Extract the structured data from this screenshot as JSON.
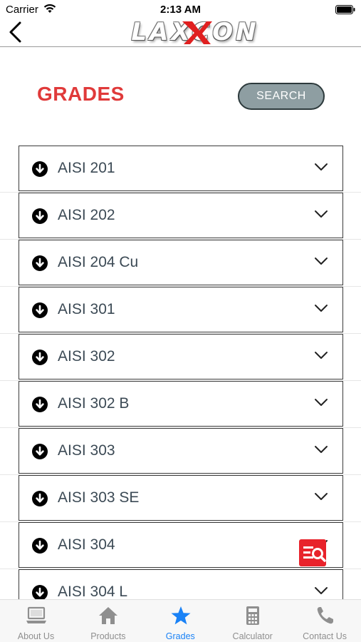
{
  "status_bar": {
    "carrier": "Carrier",
    "time": "2:13 AM"
  },
  "nav": {
    "logo_text": "LAXCON",
    "brand_color": "#e02020"
  },
  "page": {
    "title": "GRADES",
    "search_label": "SEARCH"
  },
  "grades": [
    {
      "label": "AISI 201"
    },
    {
      "label": "AISI 202"
    },
    {
      "label": "AISI 204 Cu"
    },
    {
      "label": "AISI 301"
    },
    {
      "label": "AISI 302"
    },
    {
      "label": "AISI 302 B"
    },
    {
      "label": "AISI 303"
    },
    {
      "label": "AISI 303 SE"
    },
    {
      "label": "AISI 304"
    },
    {
      "label": "AISI 304 L"
    }
  ],
  "tabs": [
    {
      "label": "About Us",
      "icon": "laptop-icon",
      "active": false
    },
    {
      "label": "Products",
      "icon": "home-icon",
      "active": false
    },
    {
      "label": "Grades",
      "icon": "star-icon",
      "active": true
    },
    {
      "label": "Calculator",
      "icon": "calculator-icon",
      "active": false
    },
    {
      "label": "Contact Us",
      "icon": "phone-icon",
      "active": false
    }
  ],
  "colors": {
    "title_red": "#e03a3a",
    "active_tab": "#1a82f6",
    "inactive_tab": "#8f8f8f",
    "search_button_bg": "#8e9ea2",
    "fab_red": "#e8232b"
  }
}
